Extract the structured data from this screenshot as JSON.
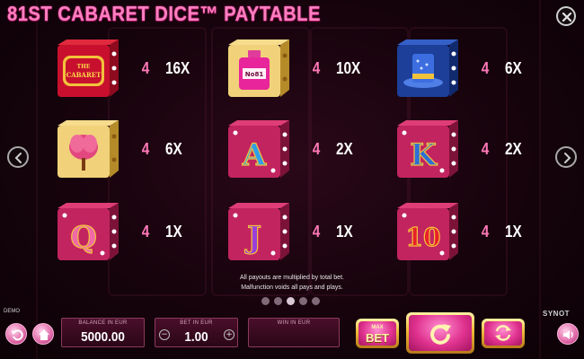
{
  "game": {
    "title": "81ST CABARET DICE™ PAYTABLE"
  },
  "paytable": [
    {
      "symbol": "the-cabaret-die",
      "count": "4",
      "multiplier": "16X",
      "die_text": "THE CABARET"
    },
    {
      "symbol": "perfume-die",
      "count": "4",
      "multiplier": "10X",
      "die_text": "No81"
    },
    {
      "symbol": "top-hat-die",
      "count": "4",
      "multiplier": "6X"
    },
    {
      "symbol": "feather-fan-die",
      "count": "4",
      "multiplier": "6X"
    },
    {
      "symbol": "ace-die",
      "count": "4",
      "multiplier": "2X",
      "die_text": "A"
    },
    {
      "symbol": "king-die",
      "count": "4",
      "multiplier": "2X",
      "die_text": "K"
    },
    {
      "symbol": "queen-die",
      "count": "4",
      "multiplier": "1X",
      "die_text": "Q"
    },
    {
      "symbol": "jack-die",
      "count": "4",
      "multiplier": "1X",
      "die_text": "J"
    },
    {
      "symbol": "ten-die",
      "count": "4",
      "multiplier": "1X",
      "die_text": "10"
    }
  ],
  "notes": {
    "line1": "All payouts are multiplied by total bet.",
    "line2": "Malfunction voids all pays and plays."
  },
  "pagination": {
    "pages": 5,
    "current": 3
  },
  "footer": {
    "demo_label": "DEMO",
    "brand": "SYNOT",
    "balance_label": "BALANCE IN EUR",
    "balance_value": "5000.00",
    "bet_label": "BET IN EUR",
    "bet_value": "1.00",
    "bet_minus": "−",
    "bet_plus": "+",
    "win_label": "WIN IN EUR",
    "win_value": "",
    "maxbet_top": "MAX",
    "maxbet_bottom": "BET"
  },
  "icons": {
    "close": "close-icon",
    "prev": "chevron-left-icon",
    "next": "chevron-right-icon",
    "back": "back-arrow-icon",
    "home": "home-icon",
    "spin": "spin-icon",
    "autoplay": "autoplay-icon",
    "sound": "speaker-icon"
  },
  "colors": {
    "accent_pink": "#ff7fbf",
    "die_red": "#c8102e",
    "die_pink": "#c2245f",
    "die_blue": "#1d3f9a",
    "gold": "#f0b93a"
  }
}
